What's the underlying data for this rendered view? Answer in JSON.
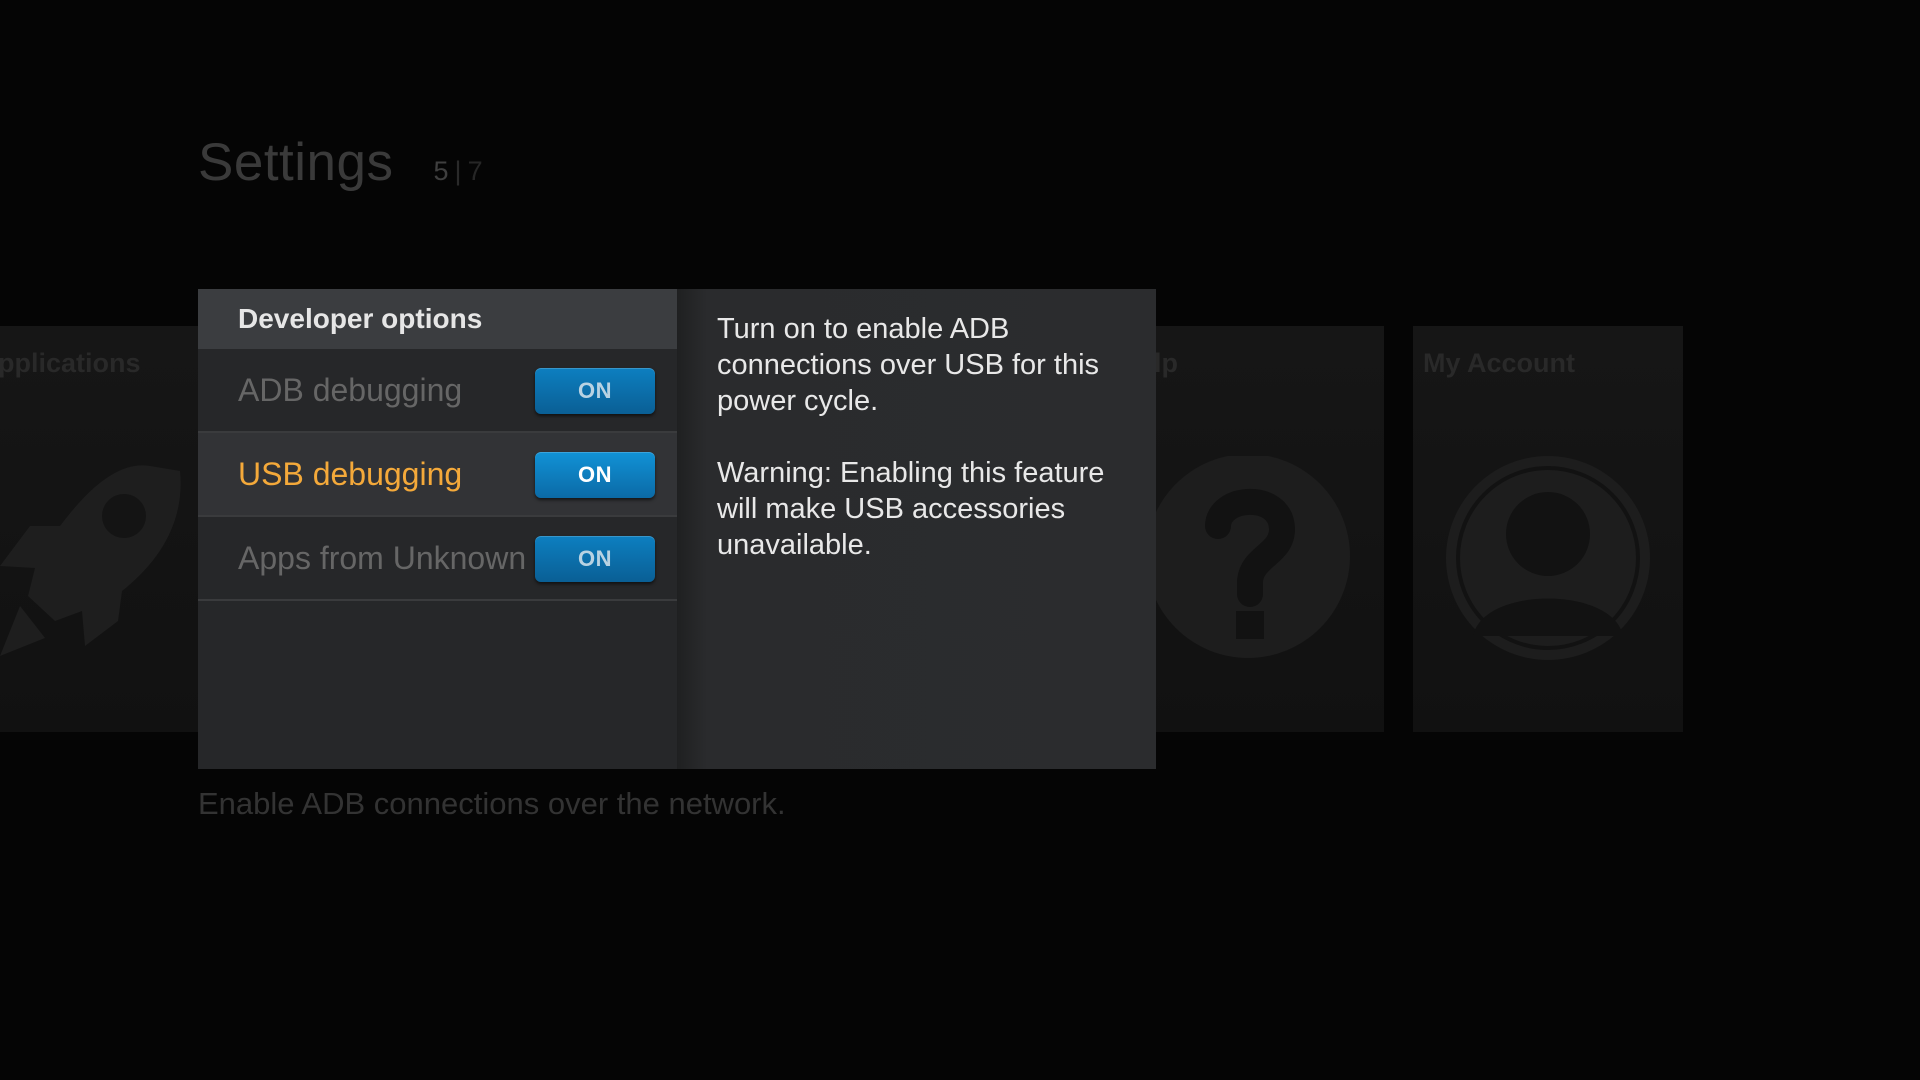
{
  "header": {
    "title": "Settings",
    "page_current": "5",
    "page_separator": "|",
    "page_total": "7"
  },
  "tiles": [
    {
      "label": "pplications",
      "icon": "rocket-icon"
    },
    {
      "label": "lp",
      "icon": "help-icon"
    },
    {
      "label": "My Account",
      "icon": "account-icon"
    }
  ],
  "dialog": {
    "title": "Developer options",
    "options": [
      {
        "label": "ADB debugging",
        "state": "ON",
        "focused": false
      },
      {
        "label": "USB debugging",
        "state": "ON",
        "focused": true
      },
      {
        "label": "Apps from Unknown Sources",
        "state": "ON",
        "focused": false
      }
    ],
    "description": "Turn on to enable ADB connections over USB for this power cycle.",
    "warning": "Warning: Enabling this feature will make USB accessories unavailable."
  },
  "footer_hint": "Enable ADB connections over the network.",
  "colors": {
    "focus_text": "#f4a93a",
    "toggle_on": "#0d7fc0",
    "panel": "#262729"
  }
}
